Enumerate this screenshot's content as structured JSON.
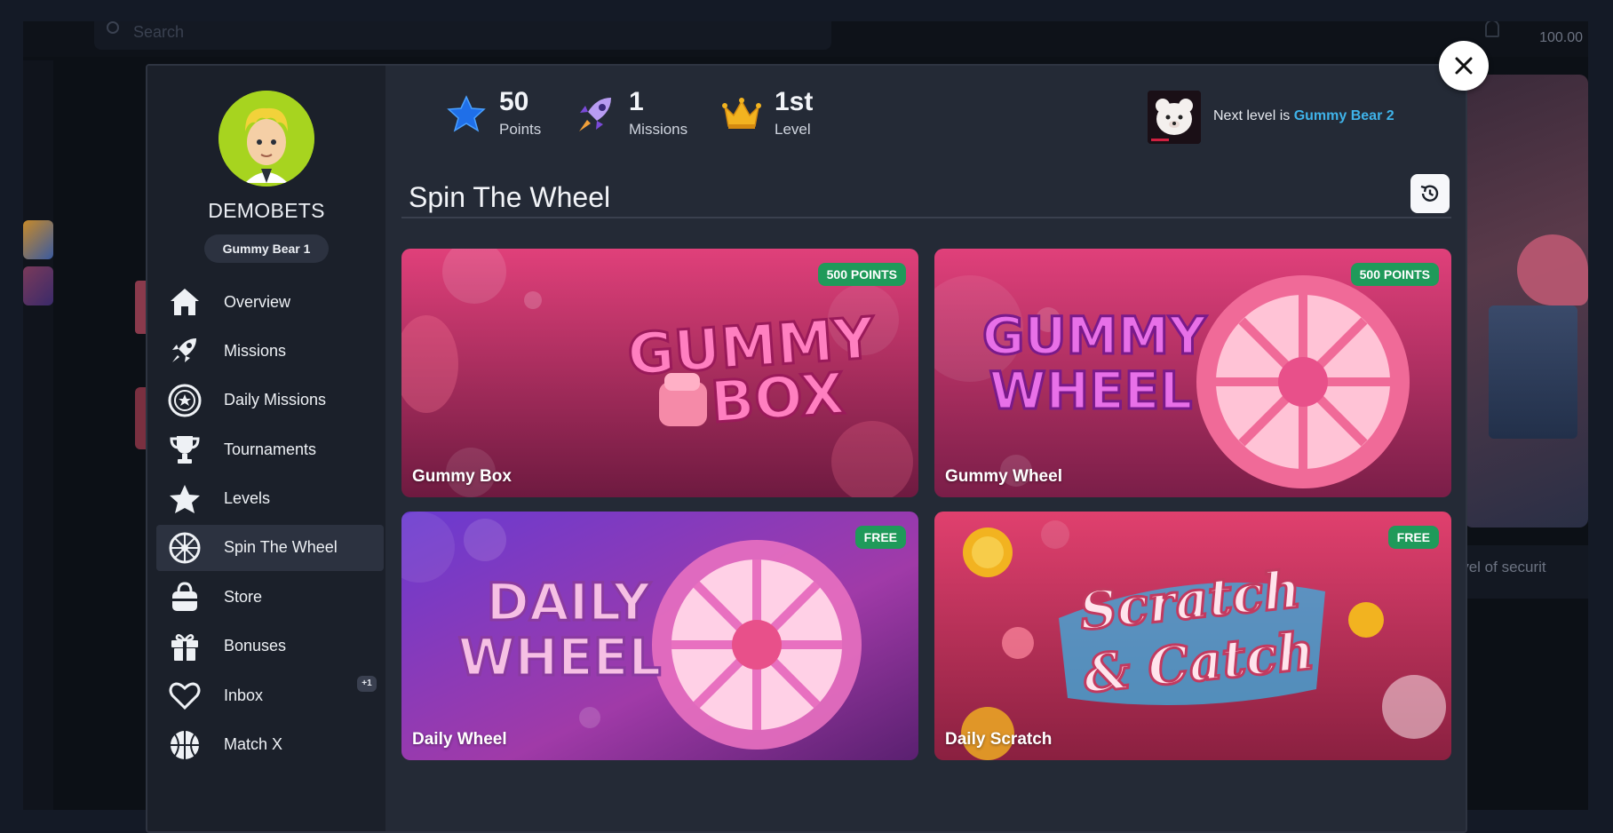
{
  "background": {
    "search_placeholder": "Search",
    "balance": "100.00",
    "right_snippet": "level of securit"
  },
  "profile": {
    "username": "DEMOBETS",
    "level_badge": "Gummy Bear 1"
  },
  "nav": {
    "items": [
      {
        "label": "Overview",
        "icon": "home-icon"
      },
      {
        "label": "Missions",
        "icon": "rocket-icon"
      },
      {
        "label": "Daily Missions",
        "icon": "star-badge-icon"
      },
      {
        "label": "Tournaments",
        "icon": "trophy-icon"
      },
      {
        "label": "Levels",
        "icon": "star-icon"
      },
      {
        "label": "Spin The Wheel",
        "icon": "wheel-icon",
        "active": true
      },
      {
        "label": "Store",
        "icon": "shopping-bag-icon"
      },
      {
        "label": "Bonuses",
        "icon": "gift-icon"
      },
      {
        "label": "Inbox",
        "icon": "heart-icon",
        "badge": "+1"
      },
      {
        "label": "Match X",
        "icon": "basketball-icon"
      }
    ]
  },
  "stats": {
    "points": {
      "value": "50",
      "label": "Points"
    },
    "missions": {
      "value": "1",
      "label": "Missions"
    },
    "level": {
      "value": "1st",
      "label": "Level"
    }
  },
  "next_level": {
    "prefix": "Next level is ",
    "name": "Gummy Bear 2"
  },
  "section": {
    "title": "Spin The Wheel"
  },
  "cards": [
    {
      "name": "Gummy Box",
      "badge": "500 POINTS",
      "art_text": [
        "GUMMY",
        "BOX"
      ]
    },
    {
      "name": "Gummy Wheel",
      "badge": "500 POINTS",
      "art_text": [
        "GUMMY",
        "WHEEL"
      ]
    },
    {
      "name": "Daily Wheel",
      "badge": "FREE",
      "art_text": [
        "DAILY",
        "WHEEL"
      ]
    },
    {
      "name": "Daily Scratch",
      "badge": "FREE",
      "art_text": [
        "Scratch",
        "& Catch"
      ]
    }
  ],
  "colors": {
    "modal_bg": "#202531",
    "sidebar_bg": "#1b202a",
    "badge_green": "#1f9a5a",
    "link_blue": "#3fb3ea",
    "card_pink": "#d93a6c",
    "card_purple": "#7a3fc4"
  }
}
